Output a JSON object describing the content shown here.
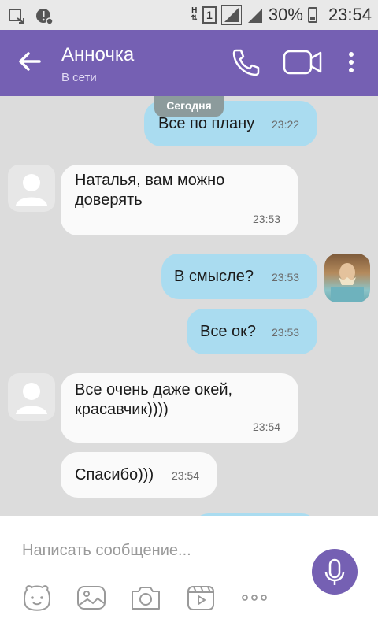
{
  "status_bar": {
    "battery": "30%",
    "time": "23:54",
    "sim": "1",
    "network": "H"
  },
  "header": {
    "contact_name": "Анночка",
    "contact_status": "В сети"
  },
  "chat": {
    "date_label": "Сегодня",
    "messages": [
      {
        "direction": "outgoing",
        "text": "Все по плану",
        "time": "23:22"
      },
      {
        "direction": "incoming",
        "text": "Наталья, вам можно доверять",
        "time": "23:53"
      },
      {
        "direction": "outgoing",
        "text": "В смысле?",
        "time": "23:53"
      },
      {
        "direction": "outgoing",
        "text": "Все ок?",
        "time": "23:53"
      },
      {
        "direction": "incoming",
        "text": "Все очень даже окей, красавчик))))",
        "time": "23:54"
      },
      {
        "direction": "incoming",
        "text": "Спасибо)))",
        "time": "23:54"
      }
    ]
  },
  "composer": {
    "placeholder": "Написать сообщение..."
  },
  "toolbar": [
    "sticker-icon",
    "gallery-icon",
    "camera-icon",
    "video-clip-icon",
    "more-options-icon"
  ],
  "colors": {
    "header": "#7560b3",
    "outgoing_bubble": "#aadcf0",
    "incoming_bubble": "#fafafa",
    "chat_background": "#dcdcdc",
    "date_pill": "#8c9b9c"
  }
}
